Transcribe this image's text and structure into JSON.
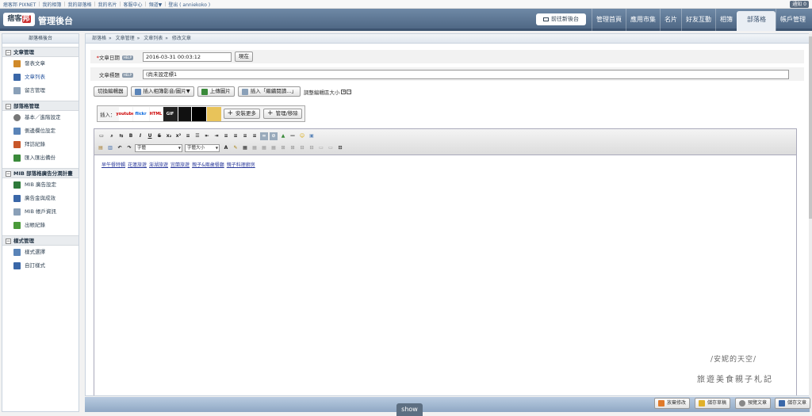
{
  "topbar": {
    "links": [
      "痞客邦 PIXNET",
      "我的相簿",
      "我的部落格",
      "我的名片",
      "客服中心",
      "頻道▼",
      "登出 ( anniekoko )"
    ],
    "notification": "通知 0"
  },
  "header": {
    "logo_text": "痞客",
    "logo_badge": "邦",
    "title": "管理後台",
    "new_backend_button": "前往新後台",
    "tabs": [
      "管理首頁",
      "應用市集",
      "名片",
      "好友互動",
      "相簿",
      "部落格",
      "帳戶管理"
    ],
    "active_tab": "部落格"
  },
  "sidebar": {
    "header": "部落格後台",
    "sections": [
      {
        "title": "文章管理",
        "items": [
          {
            "label": "發表文章",
            "icon": "pencil-icon",
            "color": "#d08a2a"
          },
          {
            "label": "文章列表",
            "icon": "list-icon",
            "color": "#3a67a8",
            "active": true
          },
          {
            "label": "留言管理",
            "icon": "comment-icon",
            "color": "#8aa0b8"
          }
        ]
      },
      {
        "title": "部落格管理",
        "items": [
          {
            "label": "基本／進階設定",
            "icon": "gear-icon",
            "color": "#777777"
          },
          {
            "label": "側邊欄位設定",
            "icon": "sidebar-icon",
            "color": "#5a84b8"
          },
          {
            "label": "拜訪紀錄",
            "icon": "footprint-icon",
            "color": "#c8572a"
          },
          {
            "label": "匯入匯出備份",
            "icon": "import-export-icon",
            "color": "#3a8a3a"
          }
        ]
      },
      {
        "title": "MIB 部落格廣告分潤計畫",
        "items": [
          {
            "label": "MIB 廣告設定",
            "icon": "ad-icon",
            "color": "#2e7a3a"
          },
          {
            "label": "廣告金與成效",
            "icon": "chart-icon",
            "color": "#3a67a8"
          },
          {
            "label": "MIB 帳戶資訊",
            "icon": "account-icon",
            "color": "#8aa0b8"
          },
          {
            "label": "出帳紀錄",
            "icon": "money-icon",
            "color": "#4a9a3a"
          }
        ]
      },
      {
        "title": "樣式管理",
        "items": [
          {
            "label": "樣式選擇",
            "icon": "template-icon",
            "color": "#5a84b8"
          },
          {
            "label": "自訂樣式",
            "icon": "custom-style-icon",
            "color": "#3a67a8"
          }
        ]
      }
    ]
  },
  "breadcrumb": [
    "部落格",
    "»",
    "文章管理",
    "»",
    "文章列表",
    "»",
    "修改文章"
  ],
  "form": {
    "date_label": "文章日期",
    "date_value": "2016-03-31 00:03:12",
    "now_button": "現在",
    "title_label": "文章標題",
    "title_value": "(尚未設定標1",
    "help_badge": "HELP"
  },
  "toolbar": {
    "switch_editor": "切換編輯器",
    "insert_media": "插入相簿影音/圖片▼",
    "upload_image": "上傳圖片",
    "insert_continue": "插入「繼續閱讀...」",
    "editor_size": "調整編輯區大小"
  },
  "plugins": {
    "label": "插入：",
    "items": [
      "youtube",
      "flickr",
      "HTML",
      "GIF",
      "Slides",
      "Map",
      "Photo"
    ],
    "install_more": "安裝更多",
    "manage": "管理/移除"
  },
  "editor": {
    "font_select": "字體",
    "size_select": "字體大小",
    "links": [
      "早午餐特輯",
      "花蓮旅遊",
      "澎湖旅遊",
      "宜蘭旅遊",
      "親子&兩歲餐廳",
      "親子料理廚房"
    ]
  },
  "watermark": {
    "line1": "/安妮的天空/",
    "line2": "旅遊美食親子札記"
  },
  "bottom": {
    "show": "show",
    "discard": "放棄修改",
    "save_draft": "儲存草稿",
    "preview": "預覽文章",
    "save_article": "儲存文章"
  }
}
